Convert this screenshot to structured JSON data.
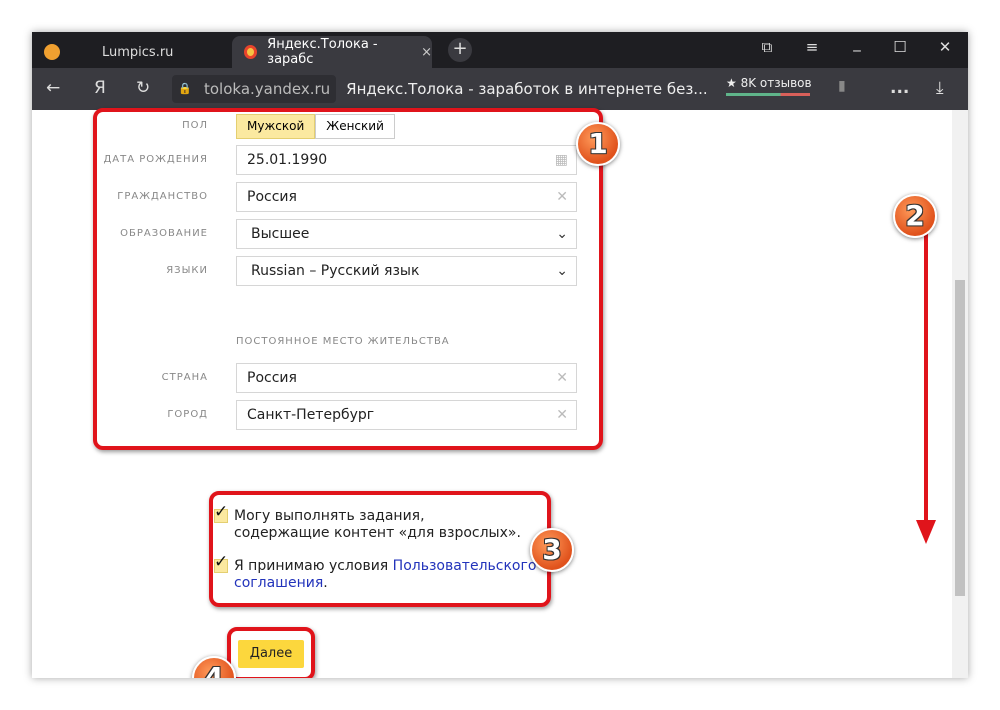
{
  "browser": {
    "tabs": [
      {
        "label": "Lumpics.ru"
      },
      {
        "label": "Яндекс.Толока - зарабс",
        "close": "×"
      }
    ],
    "new_tab": "+",
    "back": "←",
    "yandex": "Я",
    "reload": "↻",
    "domain": "toloka.yandex.ru",
    "page_title": "Яндекс.Толока - заработок в интернете без...",
    "reviews": "★ 8K отзывов",
    "more": "...",
    "download": "⤓",
    "minimize": "_",
    "maximize": "☐",
    "close": "✕",
    "menu": "≡",
    "bookmarks": "⧉",
    "bookmark": "▮"
  },
  "form": {
    "gender": {
      "label": "ПОЛ",
      "options": [
        "Мужской",
        "Женский"
      ],
      "selected": "Мужской"
    },
    "birthdate": {
      "label": "ДАТА РОЖДЕНИЯ",
      "value": "25.01.1990"
    },
    "citizenship": {
      "label": "ГРАЖДАНСТВО",
      "value": "Россия"
    },
    "education": {
      "label": "ОБРАЗОВАНИЕ",
      "value": "Высшее"
    },
    "languages": {
      "label": "ЯЗЫКИ",
      "value": "Russian – Русский язык"
    },
    "residence_heading": "ПОСТОЯННОЕ МЕСТО ЖИТЕЛЬСТВА",
    "country": {
      "label": "СТРАНА",
      "value": "Россия"
    },
    "city": {
      "label": "ГОРОД",
      "value": "Санкт-Петербург"
    },
    "adult_checkbox": {
      "checked": true,
      "line1": "Могу выполнять задания,",
      "line2": "содержащие контент «для взрослых»."
    },
    "terms_checkbox": {
      "checked": true,
      "text": "Я принимаю условия ",
      "link1": "Пользовательского",
      "link2": "соглашения",
      "tail": "."
    },
    "next_button": "Далее"
  },
  "annotations": [
    "1",
    "2",
    "3",
    "4"
  ],
  "colors": {
    "annotation_red": "#e0141b",
    "button_yellow": "#fcd73d",
    "badge_orange": "#e0521c"
  }
}
